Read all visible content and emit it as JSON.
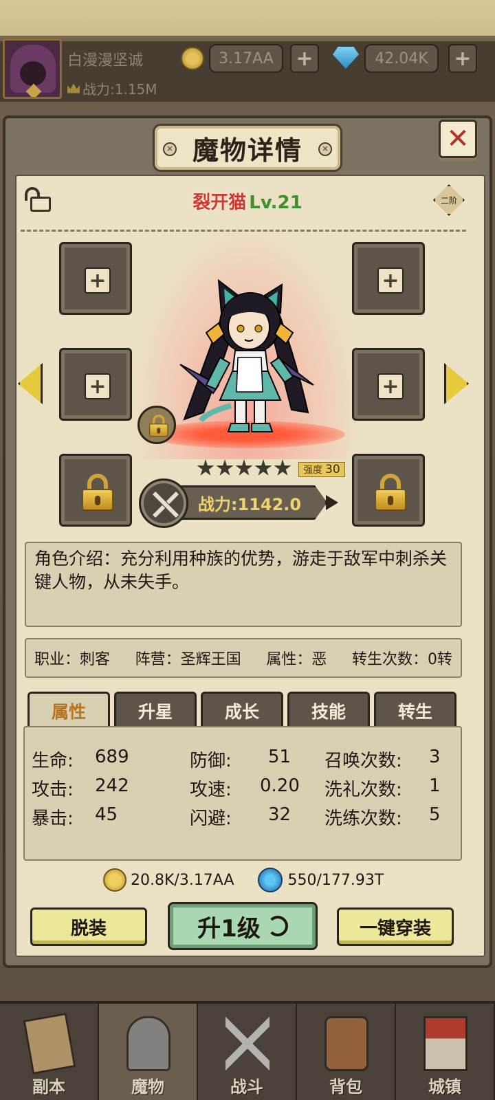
{
  "header": {
    "player_name": "白漫漫坚诚",
    "power_label": "战力:1.15M",
    "gold": "3.17AA",
    "gems": "42.04K",
    "plus": "+"
  },
  "panel": {
    "title": "魔物详情",
    "close": "✕",
    "monster_name": "裂开猫",
    "monster_level": "Lv.21",
    "tier": "二阶",
    "plus": "+",
    "strength_label": "强度",
    "strength_value": "30",
    "stars": 5,
    "power": "战力:1142.0"
  },
  "description": "角色介绍：充分利用种族的优势，游走于敌军中刺杀关键人物，从未失手。",
  "info": {
    "job": "职业：刺客",
    "faction": "阵营：圣辉王国",
    "attribute": "属性：恶",
    "rebirth": "转生次数：0转"
  },
  "tabs": [
    "属性",
    "升星",
    "成长",
    "技能",
    "转生"
  ],
  "active_tab": 0,
  "stats": {
    "hp_label": "生命:",
    "hp": "689",
    "atk_label": "攻击:",
    "atk": "242",
    "crit_label": "暴击:",
    "crit": "45",
    "def_label": "防御:",
    "def": "51",
    "spd_label": "攻速:",
    "spd": "0.20",
    "dodge_label": "闪避:",
    "dodge": "32",
    "summon_label": "召唤次数:",
    "summon": "3",
    "baptism_label": "洗礼次数:",
    "baptism": "1",
    "refine_label": "洗练次数:",
    "refine": "5"
  },
  "costs": {
    "gold": "20.8K/3.17AA",
    "orb": "550/177.93T"
  },
  "buttons": {
    "unequip": "脱装",
    "level_up": "升1级",
    "equip_all": "一键穿装"
  },
  "nav": [
    "副本",
    "魔物",
    "战斗",
    "背包",
    "城镇"
  ],
  "nav_active": 1,
  "colors": {
    "monster_name": "#d0382b",
    "level": "#3c8f2b",
    "active_tab_text": "#b6751f"
  }
}
